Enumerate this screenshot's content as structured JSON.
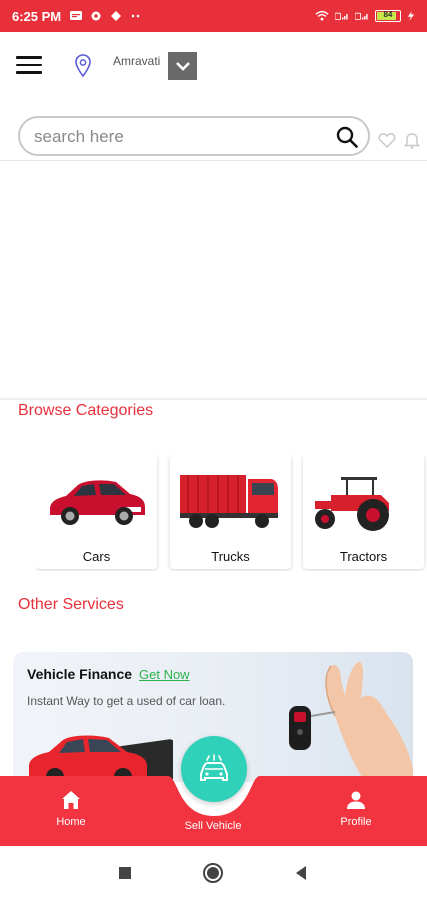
{
  "status_bar": {
    "time": "6:25 PM",
    "battery_level": "84",
    "colors": {
      "bar": "#e8303a"
    }
  },
  "header": {
    "menu_icon": "hamburger-menu-icon",
    "location_icon": "location-pin-icon",
    "location": "Amravati",
    "dropdown_icon": "chevron-down-icon"
  },
  "search": {
    "placeholder": "search here",
    "icon": "search-icon"
  },
  "actions": {
    "wishlist_icon": "heart-icon",
    "notifications_icon": "bell-icon"
  },
  "browse": {
    "title": "Browse Categories",
    "categories": [
      {
        "label": "Cars",
        "icon": "car-image"
      },
      {
        "label": "Trucks",
        "icon": "truck-image"
      },
      {
        "label": "Tractors",
        "icon": "tractor-image"
      }
    ]
  },
  "services": {
    "title": "Other Services",
    "banner": {
      "title": "Vehicle Finance",
      "link": "Get Now",
      "subtitle": "Instant Way to get a used of car loan."
    }
  },
  "bottom_nav": {
    "home": "Home",
    "sell": "Sell Vehicle",
    "profile": "Profile",
    "colors": {
      "bar": "#f1343f",
      "fab": "#2fd1b8"
    }
  },
  "accent_color": "#e8303a"
}
